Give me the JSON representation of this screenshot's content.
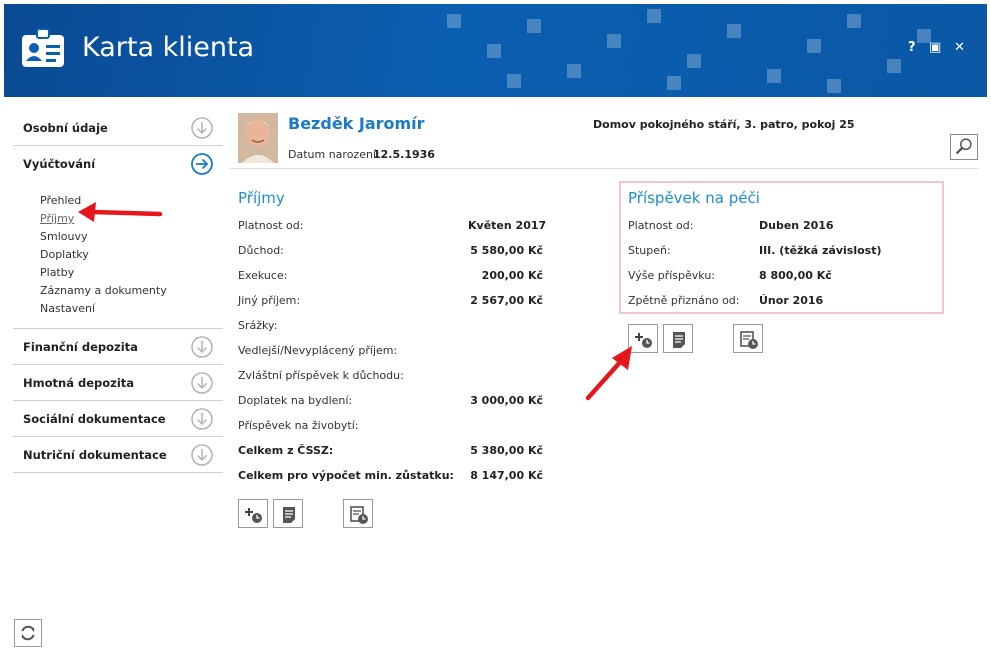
{
  "window": {
    "title": "Karta klienta",
    "controls": {
      "help": "?",
      "maximize": "▣",
      "close": "✕"
    }
  },
  "sidebar": {
    "sections": [
      {
        "label": "Osobní údaje",
        "icon": "circle-arrow-down-icon"
      },
      {
        "label": "Vyúčtování",
        "icon": "circle-arrow-right-icon",
        "expanded": true
      },
      {
        "label": "Finanční depozita",
        "icon": "circle-arrow-down-icon"
      },
      {
        "label": "Hmotná depozita",
        "icon": "circle-arrow-down-icon"
      },
      {
        "label": "Sociální dokumentace",
        "icon": "circle-arrow-down-icon"
      },
      {
        "label": "Nutriční dokumentace",
        "icon": "circle-arrow-down-icon"
      }
    ],
    "subitems": [
      "Přehled",
      "Příjmy",
      "Smlouvy",
      "Doplatky",
      "Platby",
      "Záznamy a dokumenty",
      "Nastavení"
    ],
    "active_subitem": "Příjmy"
  },
  "client": {
    "name": "Bezděk Jaromír",
    "dob_label": "Datum narození:",
    "dob_value": "12.5.1936",
    "address": "Domov pokojného stáří, 3. patro, pokoj 25"
  },
  "income": {
    "title": "Příjmy",
    "rows": [
      {
        "label": "Platnost od:",
        "value": "Květen 2017",
        "bold": false
      },
      {
        "label": "Důchod:",
        "value": "5 580,00 Kč",
        "bold": false
      },
      {
        "label": "Exekuce:",
        "value": "200,00 Kč",
        "bold": false
      },
      {
        "label": "Jiný příjem:",
        "value": "2 567,00 Kč",
        "bold": false
      },
      {
        "label": "Srážky:",
        "value": "",
        "bold": false
      },
      {
        "label": "Vedlejší/Nevyplácený příjem:",
        "value": "",
        "bold": false
      },
      {
        "label": "Zvláštní příspěvek k důchodu:",
        "value": "",
        "bold": false
      },
      {
        "label": "Doplatek na bydlení:",
        "value": "3 000,00 Kč",
        "bold": false
      },
      {
        "label": "Příspěvek na živobytí:",
        "value": "",
        "bold": false
      },
      {
        "label": "Celkem z ČSSZ:",
        "value": "5 380,00 Kč",
        "bold": true
      },
      {
        "label": "Celkem pro výpočet min. zůstatku:",
        "value": "8 147,00 Kč",
        "bold": true
      }
    ]
  },
  "care_allowance": {
    "title": "Příspěvek na péči",
    "rows": [
      {
        "label": "Platnost od:",
        "value": "Duben 2016"
      },
      {
        "label": "Stupeň:",
        "value": "III. (těžká závislost)"
      },
      {
        "label": "Výše příspěvku:",
        "value": "8 800,00 Kč"
      },
      {
        "label": "Zpětně přiznáno od:",
        "value": "Únor 2016"
      }
    ]
  },
  "action_icons": [
    "add-history-icon",
    "note-icon",
    "history-list-icon"
  ],
  "colors": {
    "header_blue": "#0b5fb0",
    "title_blue": "#1a8fd1",
    "name_blue": "#1a7ac6",
    "highlight_pink": "#f4c5c9",
    "annotation_red": "#e3171c"
  }
}
